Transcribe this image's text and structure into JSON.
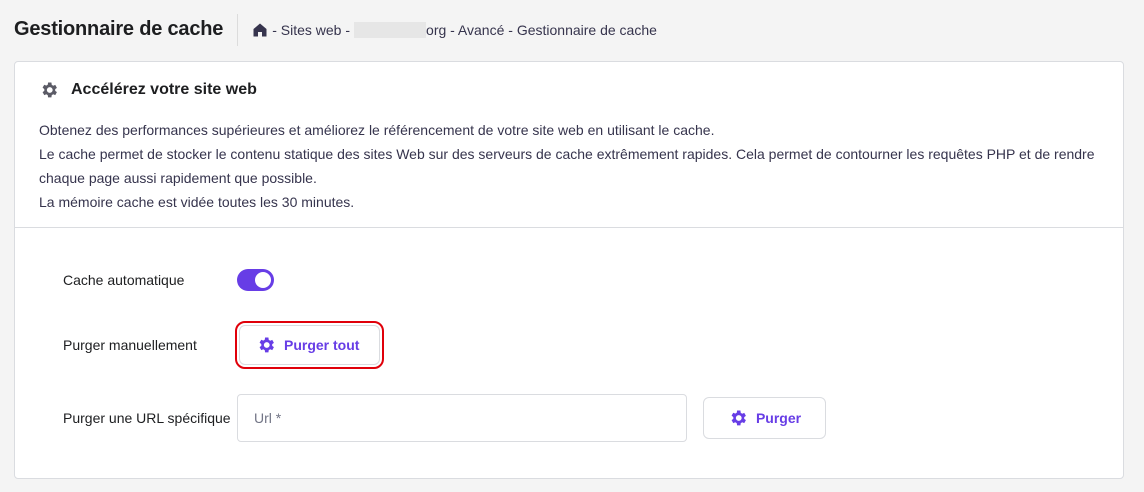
{
  "header": {
    "title": "Gestionnaire de cache",
    "breadcrumb": [
      "- Sites web -",
      "org - Avancé - Gestionnaire de cache"
    ]
  },
  "card": {
    "title": "Accélérez votre site web",
    "description": [
      "Obtenez des performances supérieures et améliorez le référencement de votre site web en utilisant le cache.",
      "Le cache permet de stocker le contenu statique des sites Web sur des serveurs de cache extrêmement rapides. Cela permet de contourner les requêtes PHP et de rendre chaque page aussi rapidement que possible.",
      "La mémoire cache est vidée toutes les 30 minutes."
    ]
  },
  "settings": {
    "auto_cache_label": "Cache automatique",
    "auto_cache_on": true,
    "manual_label": "Purger manuellement",
    "purge_all": "Purger tout",
    "url_label": "Purger une URL spécifique",
    "url_placeholder": "Url *",
    "purge": "Purger"
  },
  "colors": {
    "accent": "#673de6",
    "highlight": "#e0000a"
  }
}
